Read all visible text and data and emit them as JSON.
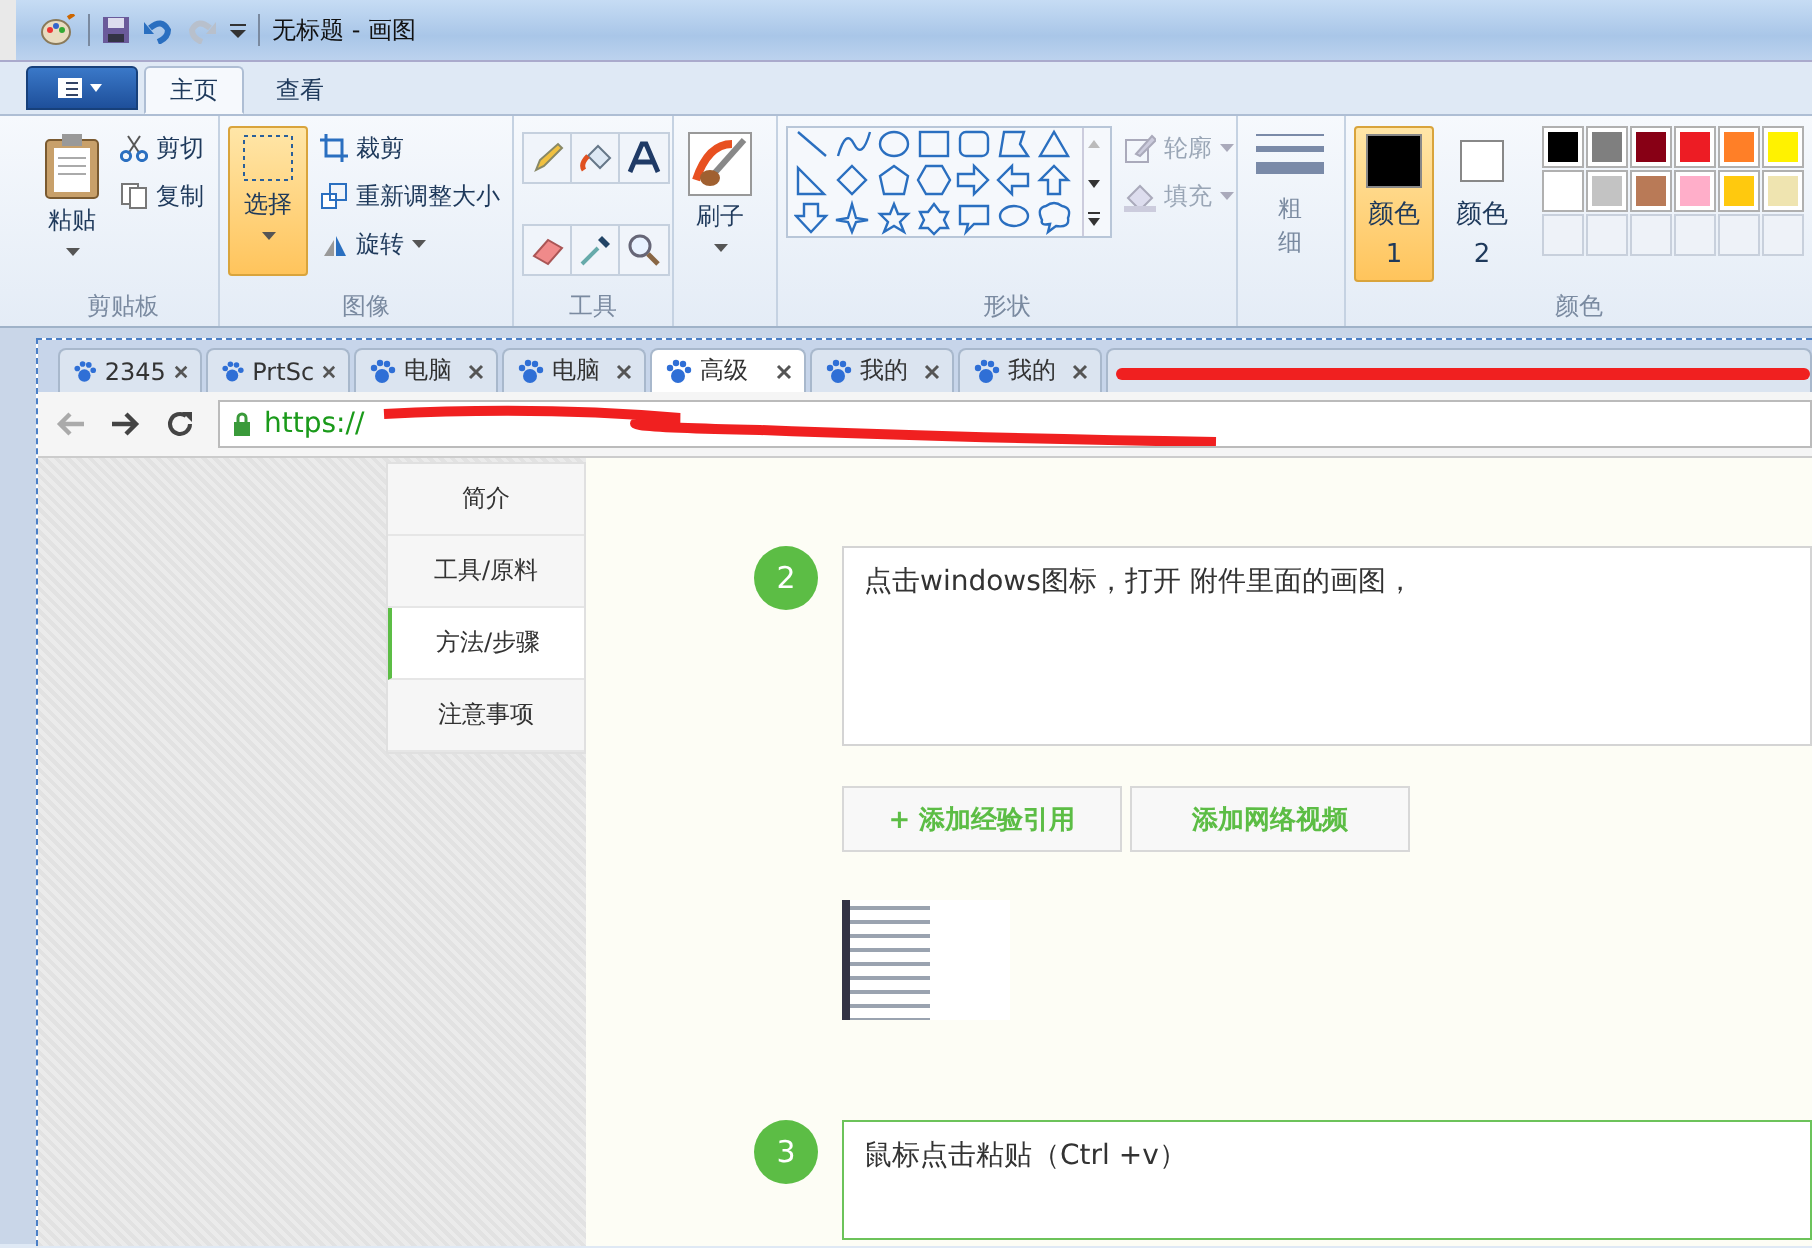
{
  "window": {
    "title": "无标题 - 画图"
  },
  "ribbon": {
    "tabs": [
      {
        "label": "主页",
        "selected": true
      },
      {
        "label": "查看",
        "selected": false
      }
    ],
    "clipboard": {
      "label": "剪贴板",
      "paste": "粘贴",
      "cut": "剪切",
      "copy": "复制"
    },
    "image": {
      "label": "图像",
      "select": {
        "label": "选择",
        "selected": true
      },
      "crop": "裁剪",
      "resize": "重新调整大小",
      "rotate": "旋转"
    },
    "tools": {
      "label": "工具"
    },
    "brushes": {
      "label": "刷子"
    },
    "shapes": {
      "label": "形状",
      "outline": {
        "label": "轮廓",
        "disabled": true
      },
      "fill": {
        "label": "填充",
        "disabled": true
      }
    },
    "size": {
      "label": "粗细"
    },
    "colors": {
      "label": "颜色",
      "color1": {
        "label": "颜色 1",
        "selected": true,
        "color": "#000000"
      },
      "color2": {
        "label": "颜色 2",
        "selected": false,
        "color": "#ffffff"
      },
      "palette": [
        {
          "color": "#000000"
        },
        {
          "color": "#7f7f7f"
        },
        {
          "color": "#880015"
        },
        {
          "color": "#ed1c24"
        },
        {
          "color": "#ff7f27"
        },
        {
          "color": "#fff200"
        },
        {
          "color": "#ffffff"
        },
        {
          "color": "#c3c3c3"
        },
        {
          "color": "#b97a57"
        },
        {
          "color": "#ffaec9"
        },
        {
          "color": "#ffc90e"
        },
        {
          "color": "#efe4b0"
        }
      ]
    }
  },
  "browser": {
    "tabs": [
      {
        "label": "2345",
        "selected": false
      },
      {
        "label": "PrtSc",
        "selected": false
      },
      {
        "label": "电脑",
        "selected": false
      },
      {
        "label": "电脑",
        "selected": false
      },
      {
        "label": "高级",
        "selected": true
      },
      {
        "label": "我的",
        "selected": false
      },
      {
        "label": "我的",
        "selected": false
      }
    ],
    "url": "https://",
    "nav": [
      {
        "label": "简介",
        "selected": false
      },
      {
        "label": "工具/原料",
        "selected": false
      },
      {
        "label": "方法/步骤",
        "selected": true
      },
      {
        "label": "注意事项",
        "selected": false
      }
    ],
    "steps": [
      {
        "number": "2",
        "text": "点击windows图标，打开 附件里面的画图，",
        "focused": false
      },
      {
        "number": "3",
        "text": "鼠标点击粘贴（Ctrl  +v）",
        "focused": true
      }
    ],
    "buttons": [
      "+ 添加经验引用",
      "添加网络视频"
    ]
  }
}
